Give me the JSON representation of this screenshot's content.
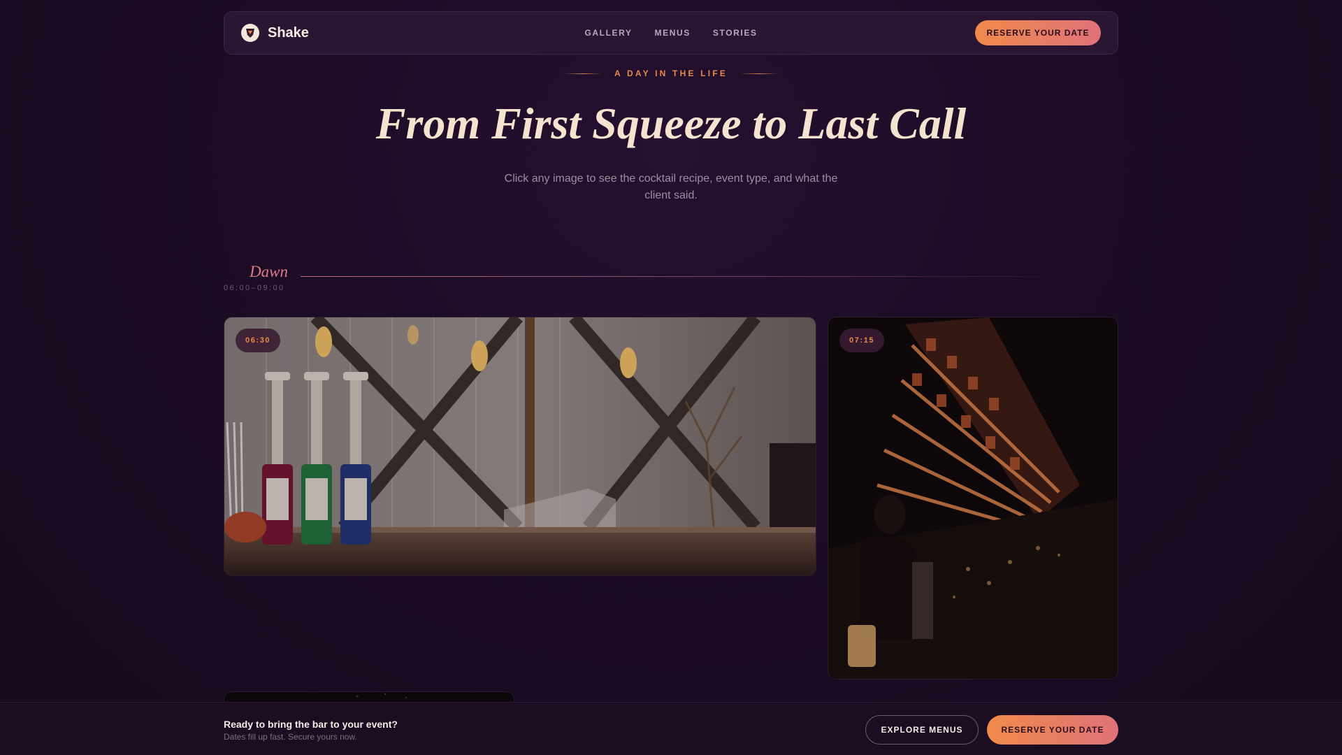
{
  "brand": {
    "name": "Shake",
    "logo_icon": "shaker-shield-icon"
  },
  "nav": {
    "links": [
      "GALLERY",
      "MENUS",
      "STORIES"
    ],
    "cta_label": "RESERVE YOUR DATE"
  },
  "hero": {
    "eyebrow": "A DAY IN THE LIFE",
    "title": "From First Squeeze to Last Call",
    "subtitle": "Click any image to see the cocktail recipe, event type, and what the client said."
  },
  "section": {
    "name": "Dawn",
    "time_range": "06:00–09:00",
    "cards": [
      {
        "time": "06:30",
        "image": "bar-counter-syrup-bottles-photo"
      },
      {
        "time": "07:15",
        "image": "bartender-backbar-shelves-photo"
      },
      {
        "image": "night-venue-photo"
      }
    ]
  },
  "cta_bar": {
    "title": "Ready to bring the bar to your event?",
    "subtitle": "Dates fill up fast. Secure yours now.",
    "secondary_label": "EXPLORE MENUS",
    "primary_label": "RESERVE YOUR DATE"
  },
  "colors": {
    "background": "#1a0b22",
    "accent_orange": "#e8894c",
    "accent_pink": "#e07a86",
    "cream": "#f4e3cf"
  }
}
